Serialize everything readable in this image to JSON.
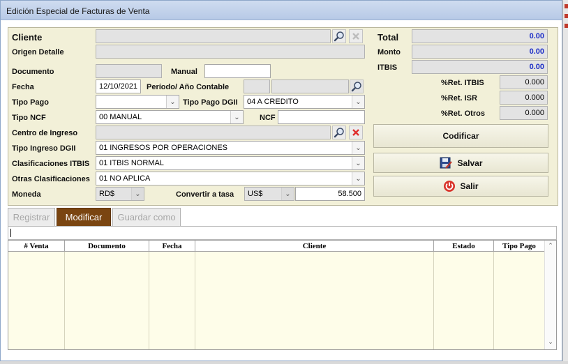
{
  "window": {
    "title": "Edición Especial de  Facturas de Venta"
  },
  "form": {
    "cliente_label": "Cliente",
    "cliente_value": "",
    "origen_label": "Origen Detalle",
    "origen_value": "",
    "documento_label": "Documento",
    "documento_value": "",
    "manual_label": "Manual",
    "manual_value": "",
    "fecha_label": "Fecha",
    "fecha_value": "12/10/2021",
    "periodo_label": "Período/ Año Contable",
    "periodo_value": "",
    "anio_value": "",
    "tipo_pago_label": "Tipo Pago",
    "tipo_pago_value": "",
    "tipo_pago_dgii_label": "Tipo Pago DGII",
    "tipo_pago_dgii_value": "04 A CREDITO",
    "tipo_ncf_label": "Tipo NCF",
    "tipo_ncf_value": "00 MANUAL",
    "ncf_label": "NCF",
    "ncf_value": "",
    "centro_label": "Centro de Ingreso",
    "centro_value": "",
    "tipo_ingreso_label": "Tipo Ingreso DGII",
    "tipo_ingreso_value": "01 INGRESOS POR OPERACIONES",
    "clasif_itbis_label": "Clasificaciones ITBIS",
    "clasif_itbis_value": "01 ITBIS NORMAL",
    "otras_clasif_label": "Otras Clasificaciones",
    "otras_clasif_value": "01 NO APLICA",
    "moneda_label": "Moneda",
    "moneda_value": "RD$",
    "convertir_label": "Convertir a tasa",
    "convertir_moneda": "US$",
    "tasa_value": "58.500"
  },
  "totals": {
    "total_label": "Total",
    "total_value": "0.00",
    "monto_label": "Monto",
    "monto_value": "0.00",
    "itbis_label": "ITBIS",
    "itbis_value": "0.00",
    "ret_itbis_label": "%Ret. ITBIS",
    "ret_itbis_value": "0.000",
    "ret_isr_label": "%Ret. ISR",
    "ret_isr_value": "0.000",
    "ret_otros_label": "%Ret. Otros",
    "ret_otros_value": "0.000"
  },
  "actions": {
    "codificar": "Codificar",
    "salvar": "Salvar",
    "salir": "Salir"
  },
  "tabs": [
    {
      "label": "Registrar",
      "state": "disabled"
    },
    {
      "label": "Modificar",
      "state": "active"
    },
    {
      "label": "Guardar como",
      "state": "disabled"
    }
  ],
  "grid": {
    "columns": [
      "# Venta",
      "Documento",
      "Fecha",
      "Cliente",
      "Estado",
      "Tipo Pago"
    ],
    "rows": []
  },
  "colors": {
    "panel_bg": "#f2f0d8",
    "grid_bg": "#fefde9",
    "active_tab": "#7a4511",
    "total_value_color": "#1e2fc7",
    "close_red": "#e03131"
  },
  "icons": {
    "search": "magnifier-icon",
    "clear": "red-x-icon",
    "dropdown": "chevron-down-icon",
    "save": "save-edit-icon",
    "exit": "power-icon"
  }
}
